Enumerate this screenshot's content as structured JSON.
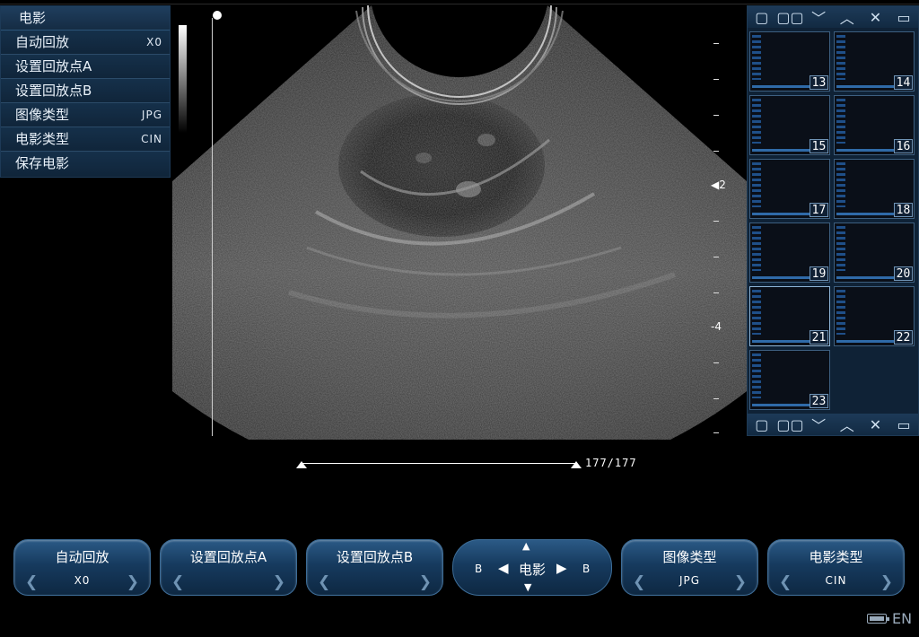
{
  "menu": {
    "title": "电影",
    "items": [
      {
        "label": "自动回放",
        "value": "X0"
      },
      {
        "label": "设置回放点A",
        "value": ""
      },
      {
        "label": "设置回放点B",
        "value": ""
      },
      {
        "label": "图像类型",
        "value": "JPG"
      },
      {
        "label": "电影类型",
        "value": "CIN"
      },
      {
        "label": "保存电影",
        "value": ""
      }
    ]
  },
  "depth": {
    "label_2": "2",
    "label_4": "-4"
  },
  "thumbnails": {
    "numbers": [
      "13",
      "14",
      "15",
      "16",
      "17",
      "18",
      "19",
      "20",
      "21",
      "22",
      "23"
    ],
    "selected": "21"
  },
  "cine": {
    "frame": "177/177"
  },
  "controls": [
    {
      "label": "自动回放",
      "value": "X0"
    },
    {
      "label": "设置回放点A",
      "value": ""
    },
    {
      "label": "设置回放点B",
      "value": ""
    },
    {
      "label": "图像类型",
      "value": "JPG"
    },
    {
      "label": "电影类型",
      "value": "CIN"
    }
  ],
  "cine_control": {
    "label": "电影",
    "left": "B",
    "right": "B"
  },
  "status": {
    "lang": "EN"
  }
}
